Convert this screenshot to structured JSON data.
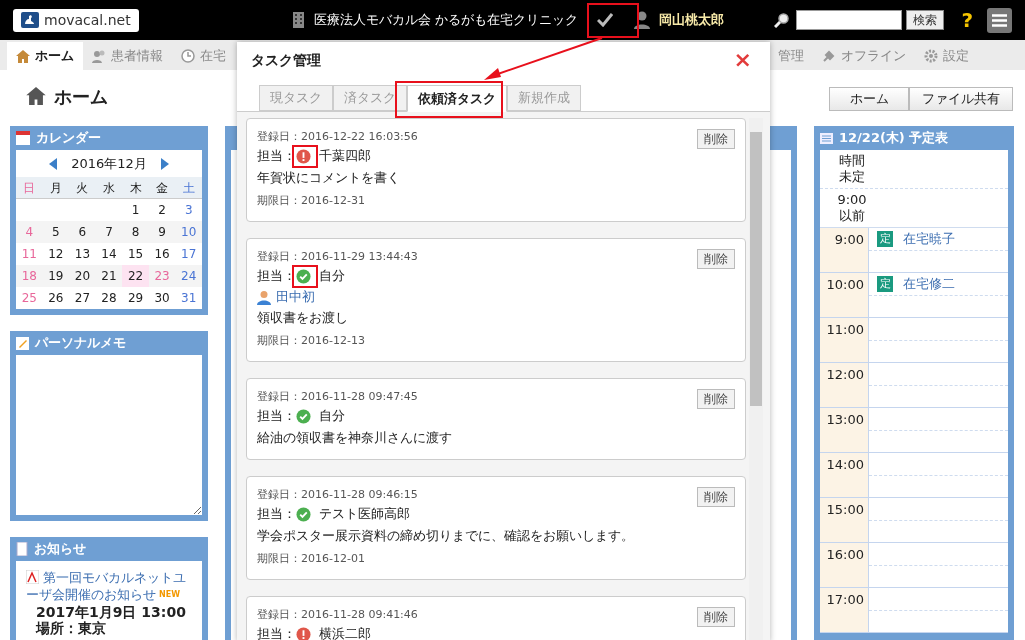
{
  "header": {
    "logo": "movacal.net",
    "clinic": "医療法人モバカル会 かるがも在宅クリニック",
    "user": "岡山桃太郎",
    "search_button": "検索",
    "help": "?"
  },
  "nav": [
    {
      "label": "ホーム",
      "selected": true
    },
    {
      "label": "患者情報",
      "selected": false
    },
    {
      "label": "在宅",
      "selected": false
    },
    {
      "label": "管理",
      "selected": false
    },
    {
      "label": "オフライン",
      "selected": false
    },
    {
      "label": "設定",
      "selected": false
    }
  ],
  "page": {
    "title": "ホーム",
    "buttons": [
      "ホーム",
      "ファイル共有"
    ]
  },
  "calendar": {
    "title": "カレンダー",
    "month": "2016年12月",
    "weekdays": [
      "日",
      "月",
      "火",
      "水",
      "木",
      "金",
      "土"
    ],
    "weeks": [
      [
        {
          "day": "1",
          "today": false,
          "holiday": false
        },
        {
          "day": "2",
          "today": false,
          "holiday": false
        },
        {
          "day": "3",
          "today": false,
          "holiday": false
        }
      ],
      [
        {
          "day": "4",
          "today": false,
          "holiday": true
        },
        {
          "day": "5",
          "today": false,
          "holiday": false
        },
        {
          "day": "6",
          "today": false,
          "holiday": false
        },
        {
          "day": "7",
          "today": false,
          "holiday": false
        },
        {
          "day": "8",
          "today": false,
          "holiday": false
        },
        {
          "day": "9",
          "today": false,
          "holiday": false
        },
        {
          "day": "10",
          "today": false,
          "holiday": false
        }
      ],
      [
        {
          "day": "11",
          "today": false,
          "holiday": true
        },
        {
          "day": "12",
          "today": false,
          "holiday": false
        },
        {
          "day": "13",
          "today": false,
          "holiday": false
        },
        {
          "day": "14",
          "today": false,
          "holiday": false
        },
        {
          "day": "15",
          "today": false,
          "holiday": false
        },
        {
          "day": "16",
          "today": false,
          "holiday": false
        },
        {
          "day": "17",
          "today": false,
          "holiday": false
        }
      ],
      [
        {
          "day": "18",
          "today": false,
          "holiday": true
        },
        {
          "day": "19",
          "today": false,
          "holiday": false
        },
        {
          "day": "20",
          "today": false,
          "holiday": false
        },
        {
          "day": "21",
          "today": false,
          "holiday": false
        },
        {
          "day": "22",
          "today": true,
          "holiday": false
        },
        {
          "day": "23",
          "today": false,
          "holiday": true
        },
        {
          "day": "24",
          "today": false,
          "holiday": false
        }
      ],
      [
        {
          "day": "25",
          "today": false,
          "holiday": true
        },
        {
          "day": "26",
          "today": false,
          "holiday": false
        },
        {
          "day": "27",
          "today": false,
          "holiday": false
        },
        {
          "day": "28",
          "today": false,
          "holiday": false
        },
        {
          "day": "29",
          "today": false,
          "holiday": false
        },
        {
          "day": "30",
          "today": false,
          "holiday": false
        },
        {
          "day": "31",
          "today": false,
          "holiday": false
        }
      ]
    ]
  },
  "memo": {
    "title": "パーソナルメモ"
  },
  "notices": {
    "title": "お知らせ",
    "items": [
      {
        "title": "第一回モバカルネットユーザ会開催のお知らせ",
        "badge": "NEW",
        "date": "2017年1月9日 13:00",
        "place": "場所：東京"
      }
    ]
  },
  "schedule": {
    "title": "12/22(木) 予定表",
    "slots": [
      {
        "kind": "untimed",
        "time": "時間未定"
      },
      {
        "kind": "untimed",
        "time": "9:00以前"
      },
      {
        "kind": "hour",
        "time": "9:00",
        "events": [
          {
            "tag": "定",
            "title": "在宅暁子"
          }
        ]
      },
      {
        "kind": "hour",
        "time": "10:00",
        "events": [
          {
            "tag": "定",
            "title": "在宅修二"
          }
        ]
      },
      {
        "kind": "hour",
        "time": "11:00"
      },
      {
        "kind": "hour",
        "time": "12:00"
      },
      {
        "kind": "hour",
        "time": "13:00"
      },
      {
        "kind": "hour",
        "time": "14:00"
      },
      {
        "kind": "hour",
        "time": "15:00"
      },
      {
        "kind": "hour",
        "time": "16:00"
      },
      {
        "kind": "hour",
        "time": "17:00"
      }
    ]
  },
  "modal": {
    "title": "タスク管理",
    "close": "×",
    "tabs": [
      {
        "label": "現タスク",
        "selected": false
      },
      {
        "label": "済タスク",
        "selected": false
      },
      {
        "label": "依頼済タスク",
        "selected": true
      },
      {
        "label": "新規作成",
        "selected": false
      }
    ],
    "tasks": [
      {
        "registered": "登録日：2016-12-22 16:03:56",
        "assignee_label": "担当：",
        "kind": "alert",
        "assignee": "千葉四郎",
        "text": "年賀状にコメントを書く",
        "due": "期限日：2016-12-31",
        "delete": "削除"
      },
      {
        "registered": "登録日：2016-11-29 13:44:43",
        "assignee_label": "担当：",
        "kind": "done",
        "assignee": "自分",
        "requester": "田中初",
        "text": "領収書をお渡し",
        "due": "期限日：2016-12-13",
        "delete": "削除"
      },
      {
        "registered": "登録日：2016-11-28 09:47:45",
        "assignee_label": "担当：",
        "kind": "done",
        "assignee": "自分",
        "text": "給油の領収書を神奈川さんに渡す",
        "delete": "削除"
      },
      {
        "registered": "登録日：2016-11-28 09:46:15",
        "assignee_label": "担当：",
        "kind": "done",
        "assignee": "テスト医師高郎",
        "text": "学会ポスター展示資料の締め切りまでに、確認をお願いします。",
        "due": "期限日：2016-12-01",
        "delete": "削除"
      },
      {
        "registered": "登録日：2016-11-28 09:41:46",
        "assignee_label": "担当：",
        "kind": "alert",
        "assignee": "横浜二郎",
        "delete": "削除"
      }
    ]
  }
}
